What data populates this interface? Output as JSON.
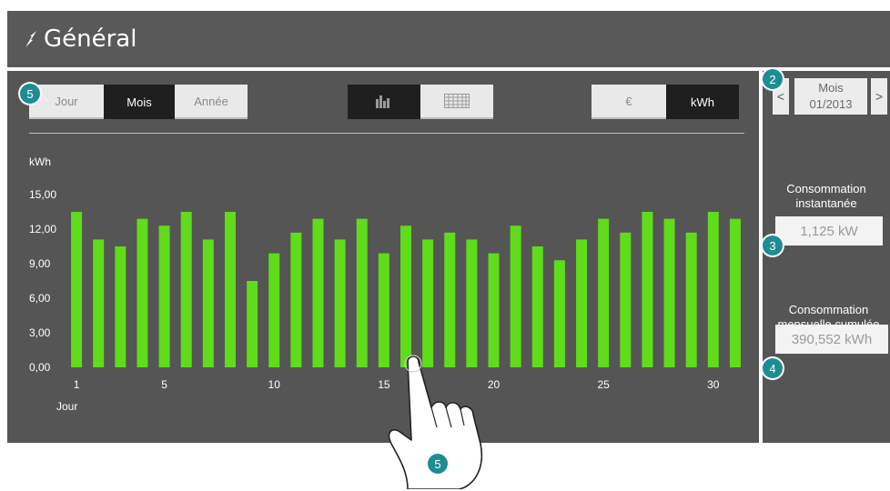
{
  "header": {
    "title": "Général"
  },
  "tabs_period": {
    "day": "Jour",
    "month": "Mois",
    "year": "Année"
  },
  "tabs_unit": {
    "euro": "€",
    "kwh": "kWh"
  },
  "period_nav": {
    "prev": "<",
    "next": ">",
    "label": "Mois",
    "value": "01/2013"
  },
  "panel": {
    "instant_label_1": "Consommation",
    "instant_label_2": "instantanée",
    "instant_value": "1,125 kW",
    "cumul_label_1": "Consommation",
    "cumul_label_2": "mensuelle cumulée",
    "cumul_value": "390,552 kWh"
  },
  "badges": {
    "b2": "2",
    "b3": "3",
    "b4": "4",
    "b5a": "5",
    "b5b": "5"
  },
  "colors": {
    "bar": "#5fdc1a",
    "background": "#555555",
    "active_tab": "#1f1f1f",
    "badge": "#1e8c93"
  },
  "chart_data": {
    "type": "bar",
    "ylabel": "kWh",
    "xlabel": "Jour",
    "ylim": [
      0,
      15
    ],
    "yticks": [
      "0,00",
      "3,00",
      "6,00",
      "9,00",
      "12,00",
      "15,00"
    ],
    "xticks": [
      1,
      5,
      10,
      15,
      20,
      25,
      30
    ],
    "x": [
      1,
      2,
      3,
      4,
      5,
      6,
      7,
      8,
      9,
      10,
      11,
      12,
      13,
      14,
      15,
      16,
      17,
      18,
      19,
      20,
      21,
      22,
      23,
      24,
      25,
      26,
      27,
      28,
      29,
      30,
      31
    ],
    "values": [
      13.5,
      11.1,
      10.5,
      12.9,
      12.3,
      13.5,
      11.1,
      13.5,
      7.5,
      9.9,
      11.7,
      12.9,
      11.1,
      12.9,
      9.9,
      12.3,
      11.1,
      11.7,
      11.1,
      9.9,
      12.3,
      10.5,
      9.3,
      11.1,
      12.9,
      11.7,
      13.5,
      12.9,
      11.7,
      13.5,
      12.9
    ]
  }
}
